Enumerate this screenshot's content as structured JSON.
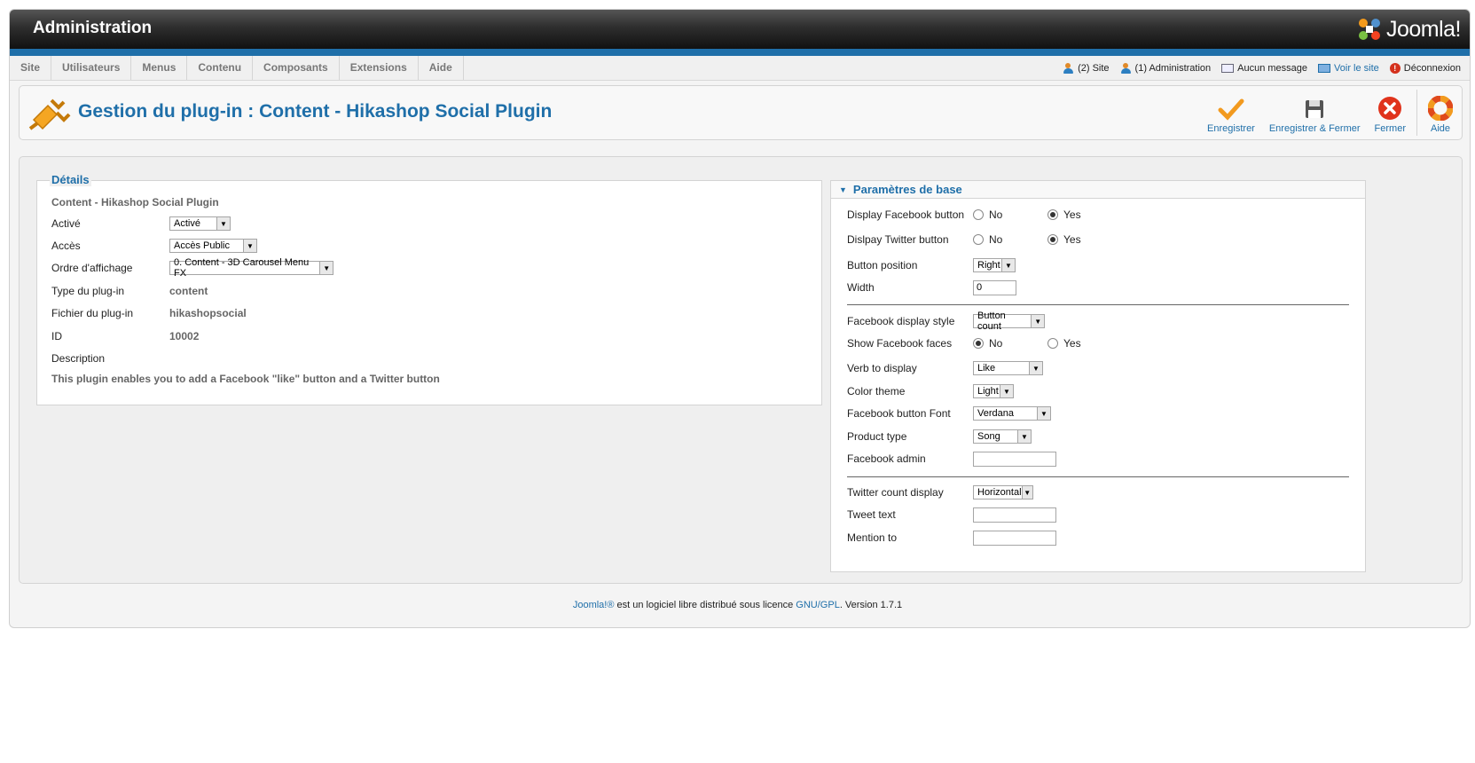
{
  "header": {
    "title": "Administration",
    "logo_text": "Joomla!"
  },
  "menu": {
    "items": [
      "Site",
      "Utilisateurs",
      "Menus",
      "Contenu",
      "Composants",
      "Extensions",
      "Aide"
    ]
  },
  "status": {
    "site_users": "(2) Site",
    "admin_users": "(1) Administration",
    "messages": "Aucun message",
    "view_site": "Voir le site",
    "logout": "Déconnexion"
  },
  "toolbar": {
    "title": "Gestion du plug-in : Content - Hikashop Social Plugin",
    "save": "Enregistrer",
    "save_close": "Enregistrer & Fermer",
    "close": "Fermer",
    "help": "Aide"
  },
  "details": {
    "legend": "Détails",
    "plugin_name": "Content - Hikashop Social Plugin",
    "enabled_label": "Activé",
    "enabled_value": "Activé",
    "access_label": "Accès",
    "access_value": "Accès Public",
    "ordering_label": "Ordre d'affichage",
    "ordering_value": "0. Content - 3D Carousel Menu FX",
    "type_label": "Type du plug-in",
    "type_value": "content",
    "file_label": "Fichier du plug-in",
    "file_value": "hikashopsocial",
    "id_label": "ID",
    "id_value": "10002",
    "description_label": "Description",
    "description_text": "This plugin enables you to add a Facebook \"like\" button and a Twitter button"
  },
  "params": {
    "header": "Paramètres de base",
    "no": "No",
    "yes": "Yes",
    "display_facebook": "Display Facebook button",
    "display_twitter": "Dislpay Twitter button",
    "button_position": "Button position",
    "button_position_value": "Right",
    "width": "Width",
    "width_value": "0",
    "fb_display_style": "Facebook display style",
    "fb_display_style_value": "Button count",
    "show_fb_faces": "Show Facebook faces",
    "verb": "Verb to display",
    "verb_value": "Like",
    "color_theme": "Color theme",
    "color_theme_value": "Light",
    "fb_font": "Facebook button Font",
    "fb_font_value": "Verdana",
    "product_type": "Product type",
    "product_type_value": "Song",
    "fb_admin": "Facebook admin",
    "fb_admin_value": "",
    "twitter_count": "Twitter count display",
    "twitter_count_value": "Horizontal",
    "tweet_text": "Tweet text",
    "tweet_text_value": "",
    "mention_to": "Mention to",
    "mention_to_value": ""
  },
  "footer": {
    "joomla_link": "Joomla!®",
    "text": " est un logiciel libre distribué sous licence ",
    "license_link": "GNU/GPL",
    "version": ".    Version 1.7.1"
  }
}
